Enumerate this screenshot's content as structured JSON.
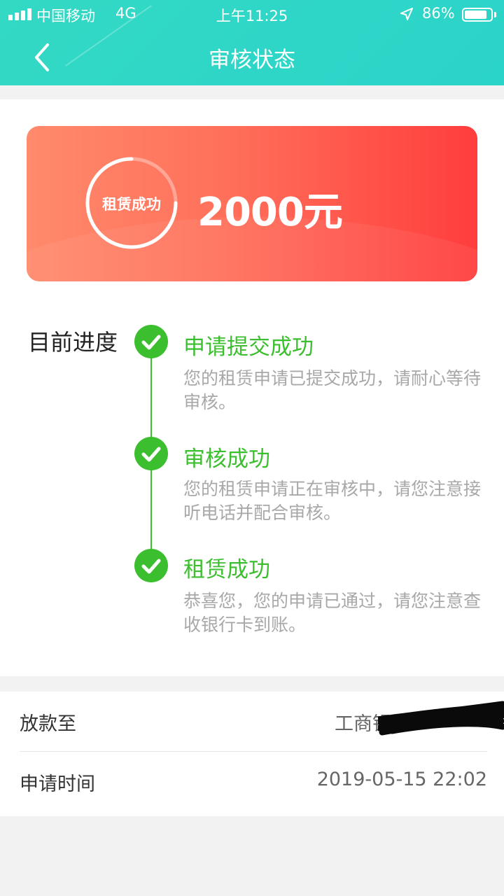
{
  "status_bar": {
    "carrier": "中国移动",
    "network": "4G",
    "time": "上午11:25",
    "battery": "86%",
    "battery_level": 0.86
  },
  "header": {
    "title": "审核状态",
    "back_icon": "chevron-left-icon"
  },
  "amount_card": {
    "status_label": "租赁成功",
    "amount": "2000元"
  },
  "progress": {
    "label": "目前进度",
    "steps": [
      {
        "title": "申请提交成功",
        "desc": "您的租赁申请已提交成功，请耐心等待审核。"
      },
      {
        "title": "审核成功",
        "desc": "您的租赁申请正在审核中，请您注意接听电话并配合审核。"
      },
      {
        "title": "租赁成功",
        "desc": "恭喜您，您的申请已通过，请您注意查收银行卡到账。"
      }
    ]
  },
  "info": {
    "rows": [
      {
        "label": "放款至",
        "value": "工商银行"
      },
      {
        "label": "申请时间",
        "value": "2019-05-15 22:02"
      }
    ]
  },
  "colors": {
    "header": "#2ed6c8",
    "accent_green": "#3cbf2e",
    "card_start": "#ff8a6c",
    "card_end": "#ff3d3d"
  }
}
